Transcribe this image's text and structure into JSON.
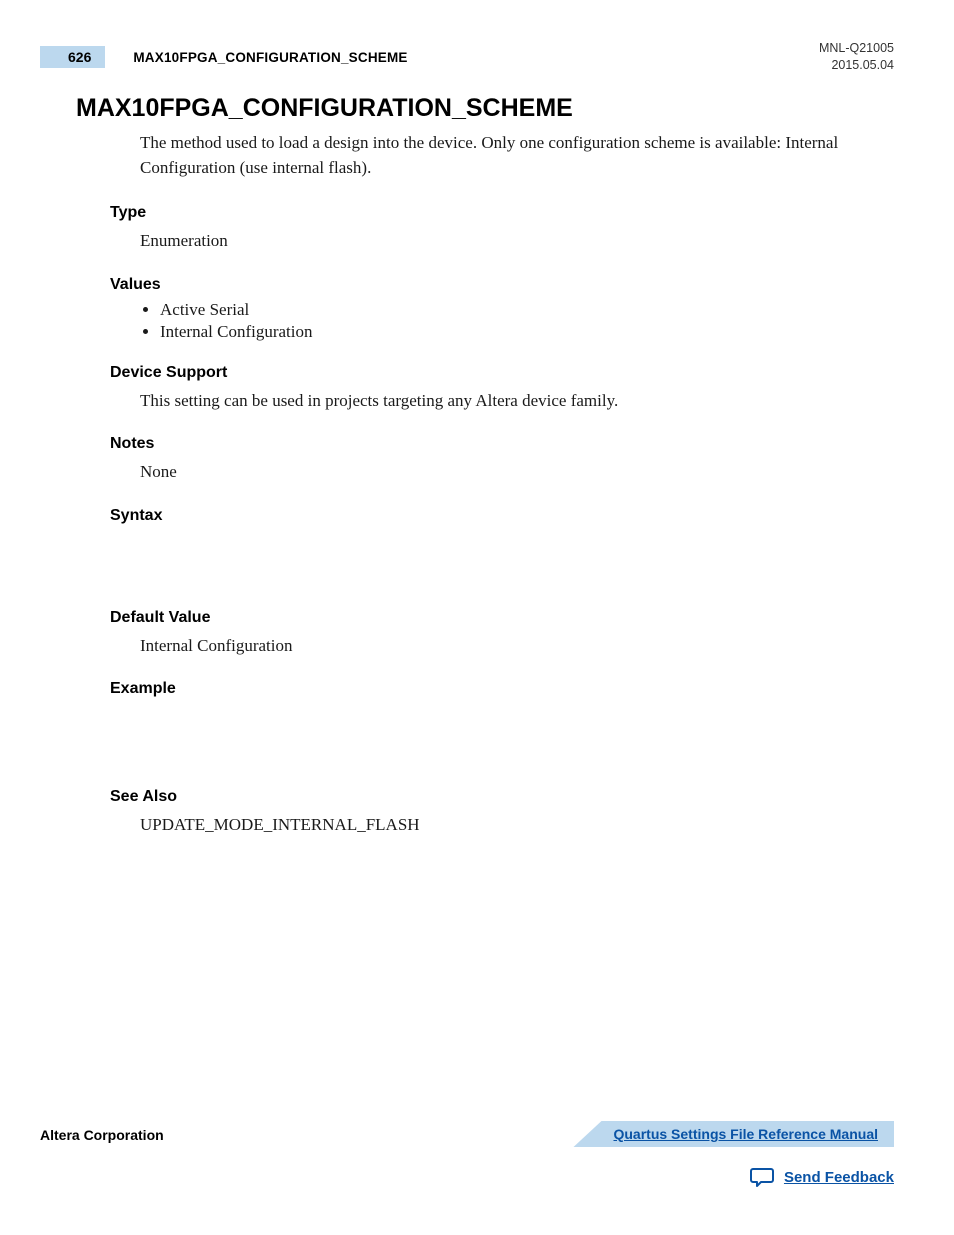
{
  "header": {
    "page_number": "626",
    "running_title": "MAX10FPGA_CONFIGURATION_SCHEME",
    "doc_id": "MNL-Q21005",
    "doc_date": "2015.05.04"
  },
  "title": "MAX10FPGA_CONFIGURATION_SCHEME",
  "intro": "The method used to load a design into the device. Only one configuration scheme is available: Internal Configuration (use internal flash).",
  "sections": {
    "type": {
      "label": "Type",
      "body": "Enumeration"
    },
    "values": {
      "label": "Values",
      "items": [
        "Active Serial",
        "Internal Configuration"
      ]
    },
    "device_support": {
      "label": "Device Support",
      "body": "This setting can be used in projects targeting any Altera device family."
    },
    "notes": {
      "label": "Notes",
      "body": "None"
    },
    "syntax": {
      "label": "Syntax",
      "body": ""
    },
    "default_value": {
      "label": "Default Value",
      "body": "Internal Configuration"
    },
    "example": {
      "label": "Example",
      "body": ""
    },
    "see_also": {
      "label": "See Also",
      "body": "UPDATE_MODE_INTERNAL_FLASH"
    }
  },
  "footer": {
    "corporation": "Altera Corporation",
    "manual_title": "Quartus Settings File Reference Manual",
    "feedback": "Send Feedback"
  }
}
